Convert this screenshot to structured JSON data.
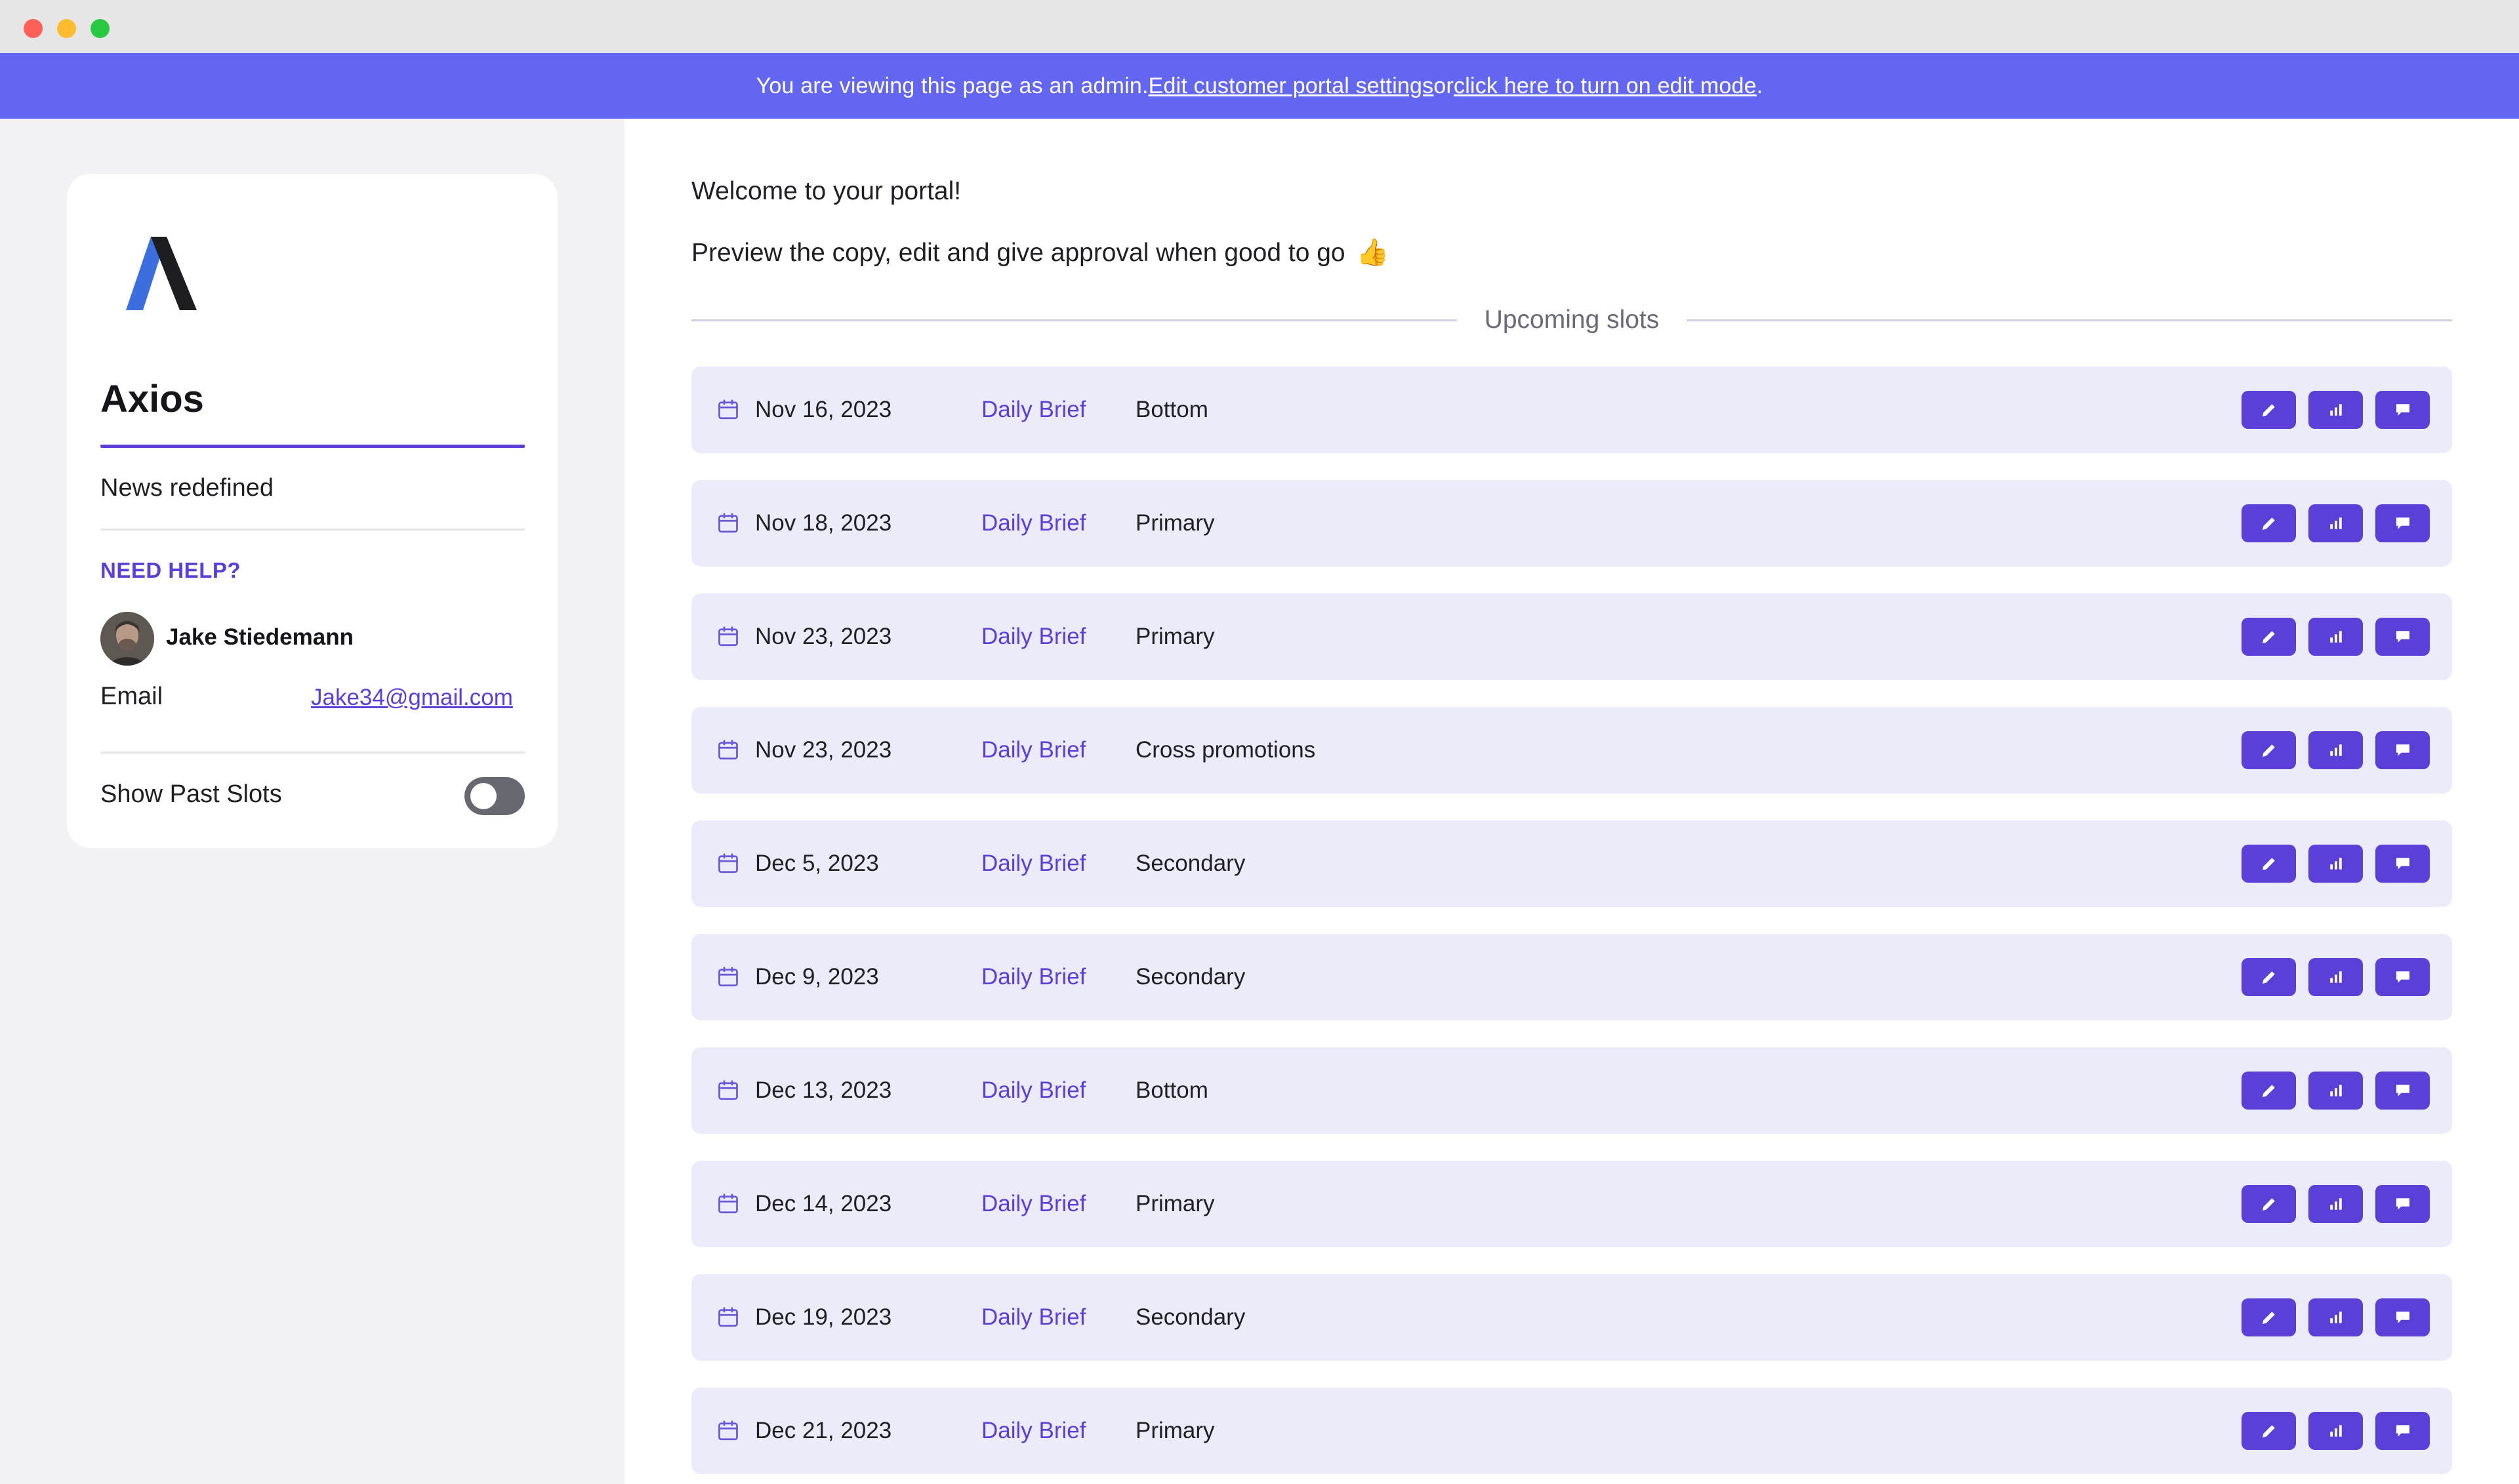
{
  "banner": {
    "prefix": "You are viewing this page as an admin. ",
    "link1": "Edit customer portal settings",
    "middle": " or ",
    "link2": "click here to turn on edit mode",
    "suffix": "."
  },
  "sidebar": {
    "brand_name": "Axios",
    "tagline": "News redefined",
    "need_help": "NEED HELP?",
    "contact_name": "Jake Stiedemann",
    "email_label": "Email",
    "email_value": "Jake34@gmail.com",
    "show_past_label": "Show Past Slots",
    "show_past_enabled": false
  },
  "main": {
    "welcome": "Welcome to your portal!",
    "preview": "Preview the copy, edit and give approval when good to go",
    "preview_emoji": "👍",
    "section_title": "Upcoming slots",
    "slots": [
      {
        "date": "Nov 16, 2023",
        "brief": "Daily Brief",
        "placement": "Bottom"
      },
      {
        "date": "Nov 18, 2023",
        "brief": "Daily Brief",
        "placement": "Primary"
      },
      {
        "date": "Nov 23, 2023",
        "brief": "Daily Brief",
        "placement": "Primary"
      },
      {
        "date": "Nov 23, 2023",
        "brief": "Daily Brief",
        "placement": "Cross promotions"
      },
      {
        "date": "Dec 5, 2023",
        "brief": "Daily Brief",
        "placement": "Secondary"
      },
      {
        "date": "Dec 9, 2023",
        "brief": "Daily Brief",
        "placement": "Secondary"
      },
      {
        "date": "Dec 13, 2023",
        "brief": "Daily Brief",
        "placement": "Bottom"
      },
      {
        "date": "Dec 14, 2023",
        "brief": "Daily Brief",
        "placement": "Primary"
      },
      {
        "date": "Dec 19, 2023",
        "brief": "Daily Brief",
        "placement": "Secondary"
      },
      {
        "date": "Dec 21, 2023",
        "brief": "Daily Brief",
        "placement": "Primary"
      }
    ]
  },
  "colors": {
    "banner": "#6366f1",
    "accent": "#5b3fd6",
    "row_bg": "#ecebf9",
    "sidebar_bg": "#f2f2f5"
  },
  "icons": {
    "slot_date": "calendar-icon",
    "edit": "pencil-icon",
    "stats": "bar-chart-icon",
    "comment": "speech-bubble-icon"
  }
}
